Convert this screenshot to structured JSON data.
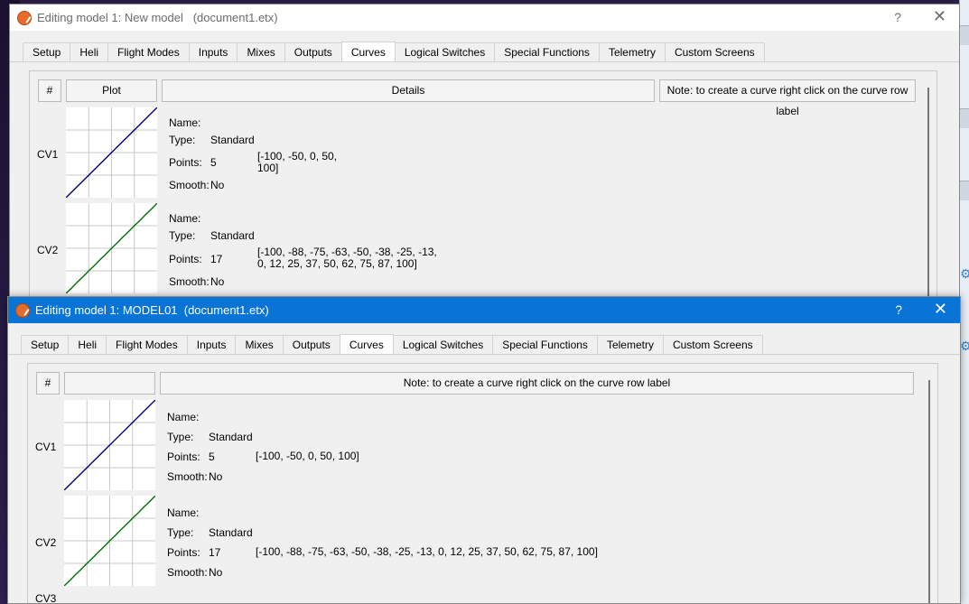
{
  "tabs": [
    "Setup",
    "Heli",
    "Flight Modes",
    "Inputs",
    "Mixes",
    "Outputs",
    "Curves",
    "Logical Switches",
    "Special Functions",
    "Telemetry",
    "Custom Screens"
  ],
  "active_tab": "Curves",
  "window_back": {
    "title": "Editing model 1: New model   (document1.etx)",
    "help_label": "?",
    "close_label": "✕",
    "headers": {
      "hash": "#",
      "plot": "Plot",
      "details": "Details",
      "note": "Note: to create a curve right click on the curve row label"
    },
    "curves": [
      {
        "label": "CV1",
        "name_label": "Name:",
        "name": "",
        "type_label": "Type:",
        "type": "Standard",
        "points_label": "Points:",
        "points": "5",
        "points_values": "[-100, -50, 0, 50,\n100]",
        "smooth_label": "Smooth:",
        "smooth": "No",
        "color": "#000080"
      },
      {
        "label": "CV2",
        "name_label": "Name:",
        "name": "",
        "type_label": "Type:",
        "type": "Standard",
        "points_label": "Points:",
        "points": "17",
        "points_values": "[-100, -88, -75, -63, -50, -38, -25, -13,\n0, 12, 25, 37, 50, 62, 75, 87, 100]",
        "smooth_label": "Smooth:",
        "smooth": "No",
        "color": "#007000"
      }
    ]
  },
  "window_front": {
    "title": "Editing model 1: MODEL01  (document1.etx)",
    "help_label": "?",
    "close_label": "✕",
    "headers": {
      "hash": "#",
      "plot": "",
      "note": "Note: to create a curve right click on the curve row label"
    },
    "curves": [
      {
        "label": "CV1",
        "name_label": "Name:",
        "name": "",
        "type_label": "Type:",
        "type": "Standard",
        "points_label": "Points:",
        "points": "5",
        "points_values": "[-100, -50, 0, 50, 100]",
        "smooth_label": "Smooth:",
        "smooth": "No",
        "color": "#000080"
      },
      {
        "label": "CV2",
        "name_label": "Name:",
        "name": "",
        "type_label": "Type:",
        "type": "Standard",
        "points_label": "Points:",
        "points": "17",
        "points_values": "[-100, -88, -75, -63, -50, -38, -25, -13, 0, 12, 25, 37, 50, 62, 75, 87, 100]",
        "smooth_label": "Smooth:",
        "smooth": "No",
        "color": "#007000"
      }
    ],
    "next_label": "CV3"
  }
}
